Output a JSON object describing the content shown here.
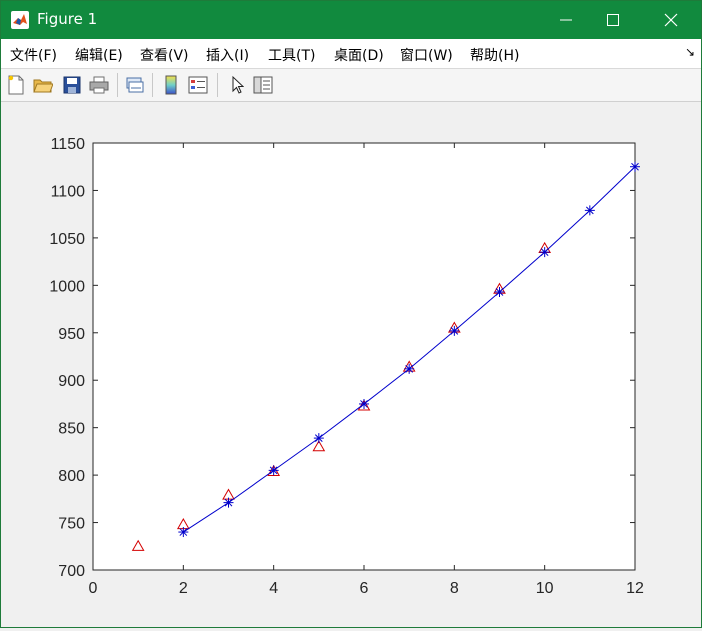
{
  "window": {
    "title": "Figure 1"
  },
  "menu": {
    "items": [
      {
        "label": "文件(F)"
      },
      {
        "label": "编辑(E)"
      },
      {
        "label": "查看(V)"
      },
      {
        "label": "插入(I)"
      },
      {
        "label": "工具(T)"
      },
      {
        "label": "桌面(D)"
      },
      {
        "label": "窗口(W)"
      },
      {
        "label": "帮助(H)"
      }
    ]
  },
  "toolbar": {
    "icons": [
      "new-figure-icon",
      "open-file-icon",
      "save-icon",
      "print-icon",
      "link-plot-icon",
      "colorbar-icon",
      "legend-icon",
      "pointer-icon",
      "property-editor-icon"
    ]
  },
  "colors": {
    "titlebar": "#118a3e",
    "measured": "#d40000",
    "fitted": "#0000cc"
  },
  "chart_data": {
    "type": "line",
    "title": "",
    "xlabel": "",
    "ylabel": "",
    "xlim": [
      0,
      12
    ],
    "ylim": [
      700,
      1150
    ],
    "xticks": [
      0,
      2,
      4,
      6,
      8,
      10,
      12
    ],
    "yticks": [
      700,
      750,
      800,
      850,
      900,
      950,
      1000,
      1050,
      1100,
      1150
    ],
    "grid": false,
    "legend": "none",
    "series": [
      {
        "marker": "triangle",
        "line": "none",
        "color": "#d40000",
        "x": [
          1,
          2,
          3,
          4,
          5,
          6,
          7,
          8,
          9,
          10
        ],
        "y": [
          725,
          748,
          779,
          804,
          830,
          873,
          914,
          955,
          996,
          1039
        ]
      },
      {
        "marker": "asterisk",
        "line": "solid",
        "color": "#0000cc",
        "x": [
          2,
          3,
          4,
          5,
          6,
          7,
          8,
          9,
          10,
          11,
          12
        ],
        "y": [
          740,
          771,
          805,
          839,
          875,
          912,
          952,
          993,
          1035,
          1079,
          1125
        ]
      }
    ]
  }
}
